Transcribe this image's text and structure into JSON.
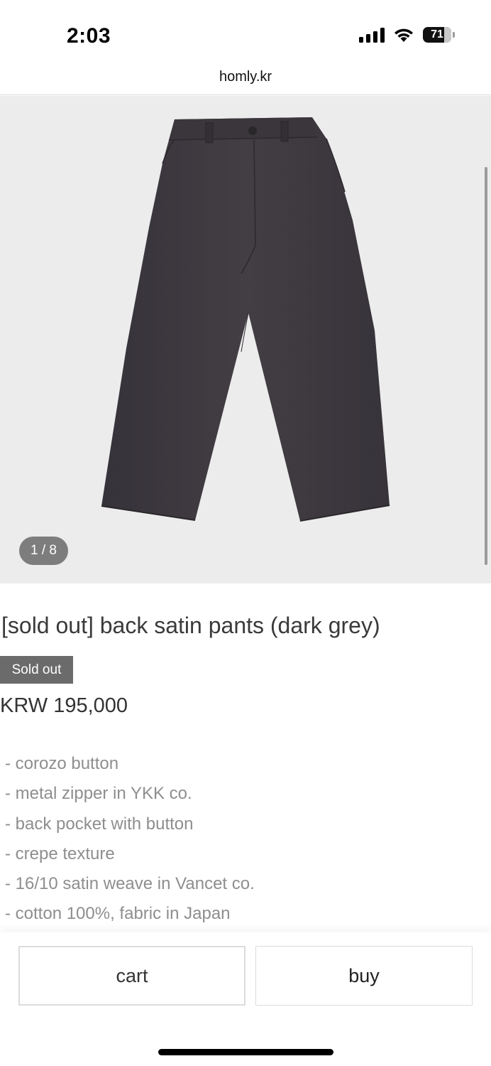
{
  "status_bar": {
    "time": "2:03",
    "battery": "71"
  },
  "browser": {
    "url": "homly.kr"
  },
  "gallery": {
    "counter": "1 / 8",
    "image_alt": "dark grey pants"
  },
  "product": {
    "title": "[sold out] back satin pants (dark grey)",
    "badge": "Sold out",
    "price": "KRW 195,000",
    "features": [
      "- corozo button",
      "- metal zipper in YKK co.",
      "- back pocket with button",
      "- crepe texture",
      "- 16/10 satin weave in Vancet co.",
      "- cotton 100%, fabric in Japan"
    ]
  },
  "actions": {
    "cart_label": "cart",
    "buy_label": "buy"
  },
  "colors": {
    "badge_bg": "#6b6b6b",
    "gallery_bg": "#ececec",
    "pants": "#3e3a3d"
  }
}
